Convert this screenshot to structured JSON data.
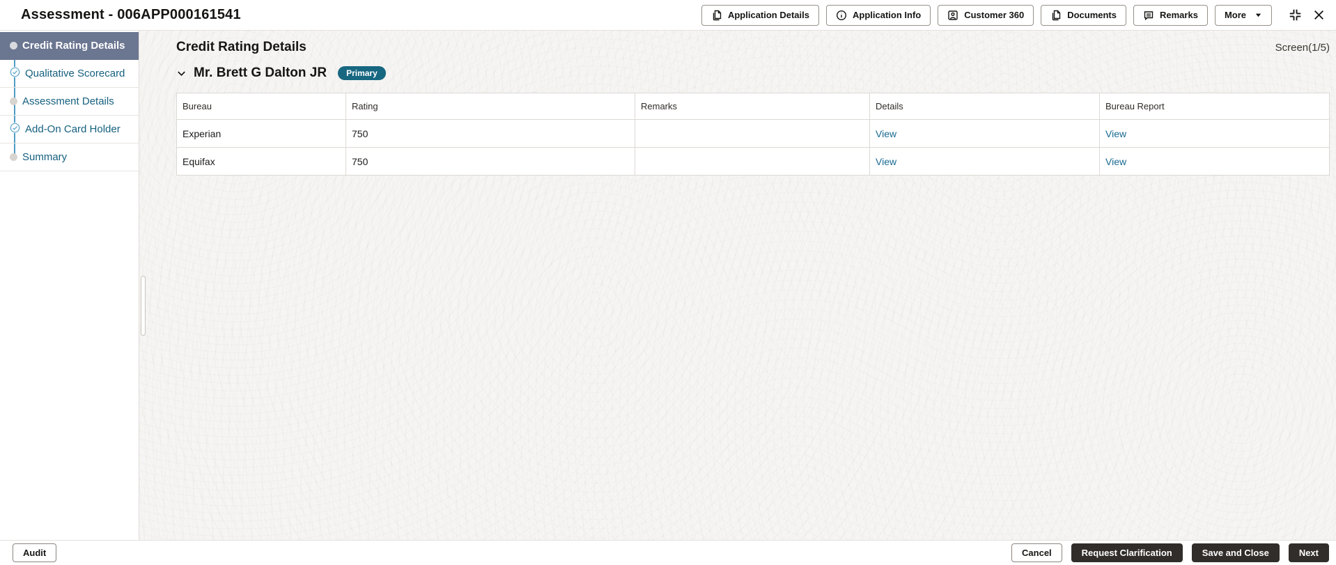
{
  "window": {
    "title": "Assessment - 006APP000161541"
  },
  "header": {
    "buttons": [
      {
        "label": "Application Details",
        "icon": "document-icon"
      },
      {
        "label": "Application Info",
        "icon": "info-icon"
      },
      {
        "label": "Customer 360",
        "icon": "person-card-icon"
      },
      {
        "label": "Documents",
        "icon": "document-icon"
      },
      {
        "label": "Remarks",
        "icon": "speech-bubble-icon"
      },
      {
        "label": "More",
        "icon": "caret-down-icon"
      }
    ],
    "window_controls": [
      {
        "name": "collapse-icon"
      },
      {
        "name": "close-icon"
      }
    ]
  },
  "sidebar": {
    "items": [
      {
        "label": "Credit Rating Details",
        "state": "active",
        "icon": "bullet-icon"
      },
      {
        "label": "Qualitative Scorecard",
        "state": "completed",
        "icon": "check-circle-icon"
      },
      {
        "label": "Assessment Details",
        "state": "pending",
        "icon": "circle-icon"
      },
      {
        "label": "Add-On Card Holder",
        "state": "completed",
        "icon": "check-circle-icon"
      },
      {
        "label": "Summary",
        "state": "pending",
        "icon": "circle-icon"
      }
    ]
  },
  "main": {
    "title": "Credit Rating Details",
    "screen_indicator": "Screen(1/5)",
    "customer": {
      "name": "Mr. Brett G Dalton JR",
      "badge": "Primary"
    },
    "table": {
      "columns": [
        "Bureau",
        "Rating",
        "Remarks",
        "Details",
        "Bureau Report"
      ],
      "rows": [
        {
          "bureau": "Experian",
          "rating": "750",
          "remarks": "",
          "details_link": "View",
          "bureau_report_link": "View"
        },
        {
          "bureau": "Equifax",
          "rating": "750",
          "remarks": "",
          "details_link": "View",
          "bureau_report_link": "View"
        }
      ]
    }
  },
  "footer": {
    "audit": "Audit",
    "cancel": "Cancel",
    "request_clarification": "Request Clarification",
    "save_and_close": "Save and Close",
    "next": "Next"
  },
  "colors": {
    "link": "#176990",
    "primary_badge": "#176781",
    "active_step_bg": "#6B7691",
    "dark_button_bg": "#312D2A",
    "step_connector": "#4F9CC4"
  }
}
